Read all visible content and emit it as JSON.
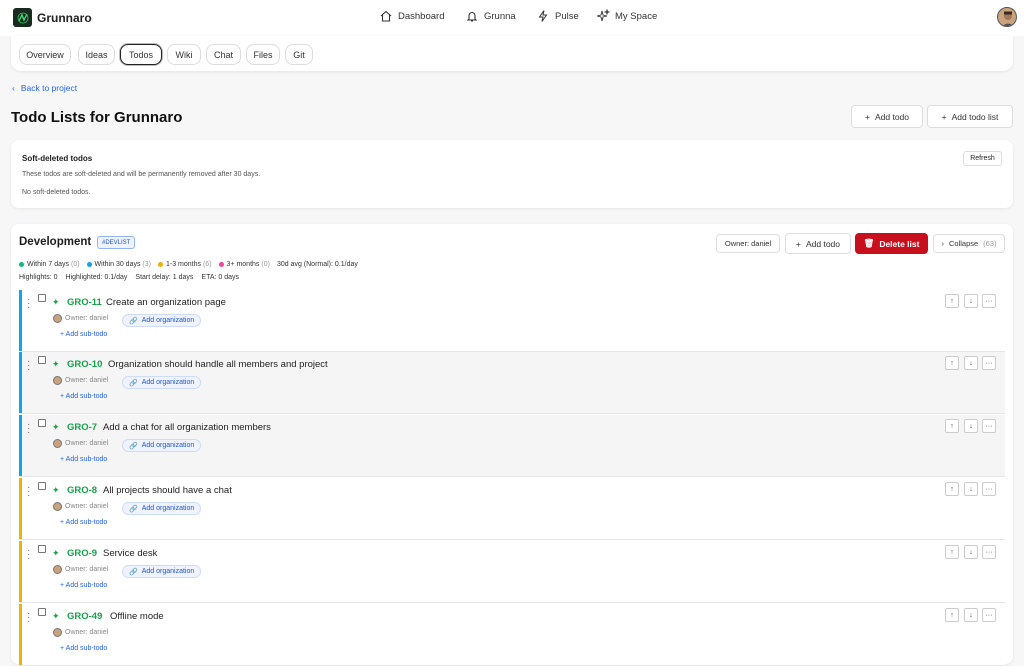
{
  "app": {
    "name": "Grunnaro"
  },
  "nav": [
    {
      "label": "Dashboard"
    },
    {
      "label": "Grunna"
    },
    {
      "label": "Pulse"
    },
    {
      "label": "My Space"
    }
  ],
  "tabs": [
    {
      "label": "Overview"
    },
    {
      "label": "Ideas"
    },
    {
      "label": "Todos"
    },
    {
      "label": "Wiki"
    },
    {
      "label": "Chat"
    },
    {
      "label": "Files"
    },
    {
      "label": "Git"
    }
  ],
  "back_label": "Back to project",
  "page_title": "Todo Lists for Grunnaro",
  "header_buttons": {
    "add_todo": "Add todo",
    "add_todo_list": "Add todo list"
  },
  "soft_deleted": {
    "title": "Soft-deleted todos",
    "description": "These todos are soft-deleted and will be permanently removed after 30 days.",
    "empty": "No soft-deleted todos.",
    "refresh": "Refresh"
  },
  "list": {
    "title": "Development",
    "tag": "#DEVLIST",
    "owner": "Owner: daniel",
    "add_todo": "Add todo",
    "delete": "Delete list",
    "collapse": "Collapse",
    "collapse_count": "(63)",
    "legend": [
      {
        "label": "Within 7 days",
        "count": "(0)",
        "color": "#10b981"
      },
      {
        "label": "Within 30 days",
        "count": "(3)",
        "color": "#0ea5e9"
      },
      {
        "label": "1-3 months",
        "count": "(6)",
        "color": "#eab308"
      },
      {
        "label": "3+ months",
        "count": "(0)",
        "color": "#ec4899"
      }
    ],
    "avg": "30d avg (Normal): 0.1/day",
    "stats": [
      "Highlights: 0",
      "Highlighted: 0.1/day",
      "Start delay: 1 days",
      "ETA: 0 days"
    ],
    "todos": [
      {
        "key": "GRO-11",
        "title": "Create an organization page",
        "owner": "Owner: daniel",
        "org": "Add organization",
        "sub": "+ Add sub-todo",
        "color": "#0ea5e9"
      },
      {
        "key": "GRO-10",
        "title": "Organization should handle all members and project",
        "owner": "Owner: daniel",
        "org": "Add organization",
        "sub": "+ Add sub-todo",
        "color": "#0ea5e9"
      },
      {
        "key": "GRO-7",
        "title": "Add a chat for all organization members",
        "owner": "Owner: daniel",
        "org": "Add organization",
        "sub": "+ Add sub-todo",
        "color": "#0ea5e9"
      },
      {
        "key": "GRO-8",
        "title": "All projects should have a chat",
        "owner": "Owner: daniel",
        "org": "Add organization",
        "sub": "+ Add sub-todo",
        "color": "#eab308"
      },
      {
        "key": "GRO-9",
        "title": "Service desk",
        "owner": "Owner: daniel",
        "org": "Add organization",
        "sub": "+ Add sub-todo",
        "color": "#eab308"
      },
      {
        "key": "GRO-49",
        "title": "Offline mode",
        "owner": "Owner: daniel",
        "org": "",
        "sub": "+ Add sub-todo",
        "color": "#eab308"
      }
    ],
    "ctrl": {
      "up": "↑",
      "down": "↓",
      "more": "···"
    }
  }
}
